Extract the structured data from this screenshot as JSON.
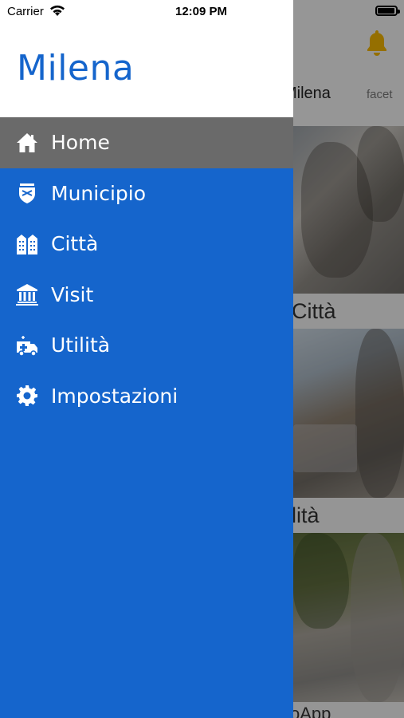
{
  "status_bar": {
    "carrier": "Carrier",
    "time": "12:09 PM",
    "battery_level": 0.95
  },
  "drawer": {
    "title": "Milena",
    "items": [
      {
        "label": "Home",
        "icon": "home-icon",
        "active": true
      },
      {
        "label": "Municipio",
        "icon": "coat-of-arms-icon",
        "active": false
      },
      {
        "label": "Città",
        "icon": "buildings-icon",
        "active": false
      },
      {
        "label": "Visit",
        "icon": "museum-icon",
        "active": false
      },
      {
        "label": "Utilità",
        "icon": "ambulance-icon",
        "active": false
      },
      {
        "label": "Impostazioni",
        "icon": "gear-icon",
        "active": false
      }
    ]
  },
  "background": {
    "tabs": [
      "Milena",
      "facet"
    ],
    "tiles": [
      "Città",
      "lità",
      "oApp"
    ],
    "icons": [
      "bell-icon"
    ]
  },
  "colors": {
    "drawer_bg": "#1565cc",
    "active_item_bg": "#6a6a6a",
    "title_color": "#1565cc",
    "bell_color": "#f0b400"
  }
}
